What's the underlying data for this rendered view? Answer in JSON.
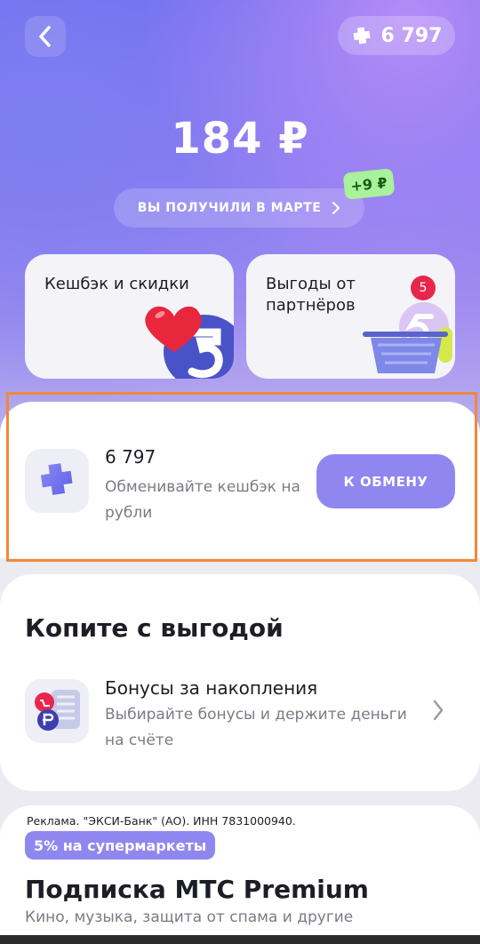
{
  "header": {
    "back_icon": "chevron-left-icon",
    "balance_pill": {
      "icon": "plus-cashback-icon",
      "value": "6 797"
    }
  },
  "summary": {
    "amount": "184 ₽",
    "month_label": "ВЫ ПОЛУЧИЛИ В МАРТЕ",
    "bonus_badge": "+9 ₽"
  },
  "cards": [
    {
      "title": "Кешбэк и скидки",
      "illustration": "heart-cashback-coin-icon"
    },
    {
      "title": "Выгоды от партнёров",
      "badge": "5",
      "illustration": "shopping-basket-icon"
    }
  ],
  "exchange": {
    "value": "6 797",
    "description": "Обменивайте кешбэк на рубли",
    "button_label": "К ОБМЕНУ",
    "icon": "plus-cashback-icon"
  },
  "savings": {
    "title": "Копите с выгодой",
    "item": {
      "name": "Бонусы за накопления",
      "description": "Выбирайте бонусы и держите деньги на счёте",
      "icon": "bonus-calendar-icon"
    }
  },
  "promo": {
    "ad_text": "Реклама. \"ЭКСИ-Банк\" (АО). ИНН 7831000940.",
    "tag": "5% на супермаркеты",
    "title": "Подписка МТС Premium",
    "description": "Кино, музыка, защита от спама и другие"
  },
  "colors": {
    "accent": "#8f87ef",
    "badge_green": "#a7f29a",
    "badge_red": "#e8264c",
    "highlight": "#f0883a"
  }
}
